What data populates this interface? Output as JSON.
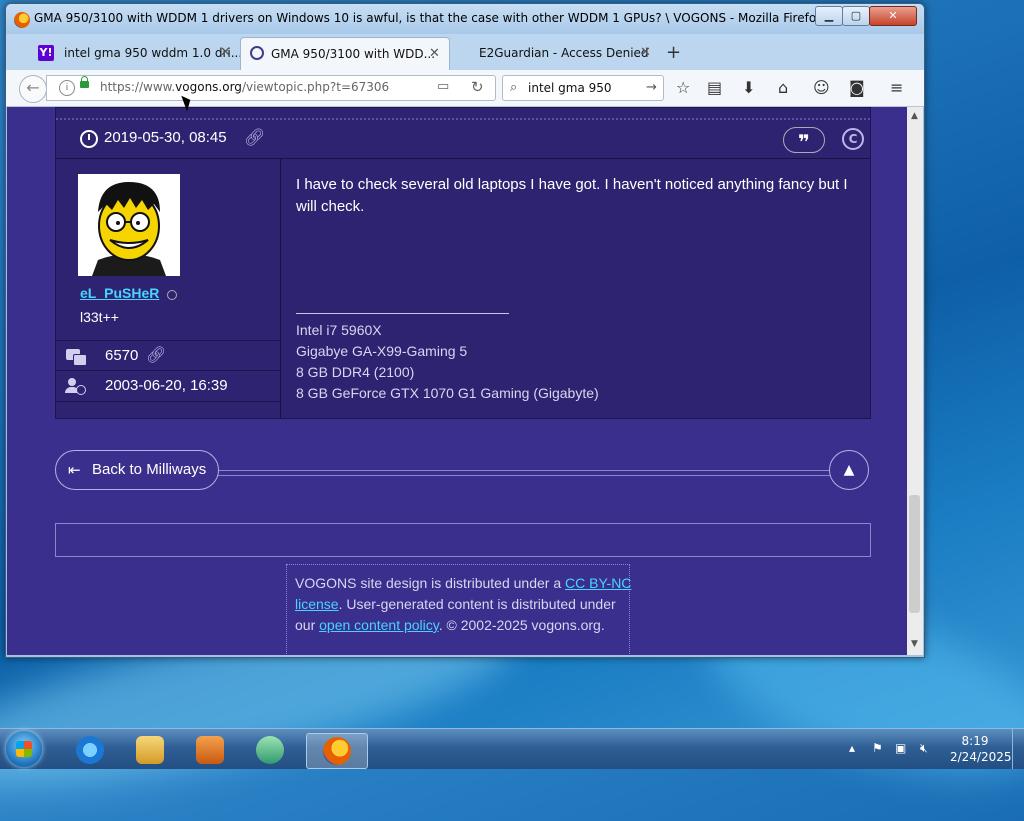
{
  "window": {
    "title": "GMA 950/3100 with WDDM 1 drivers on Windows 10 is awful, is that the case with other WDDM 1 GPUs? \\ VOGONS - Mozilla Firefox",
    "minimize": "▁",
    "maximize": "▢",
    "close": "✕"
  },
  "tabs": [
    {
      "label": "intel gma 950 wddm 1.0 dri...",
      "favicon": "Y!"
    },
    {
      "label": "GMA 950/3100 with WDD..."
    },
    {
      "label": "E2Guardian - Access Denied"
    }
  ],
  "tab_close": "✕",
  "new_tab": "+",
  "nav": {
    "url_prefix": "https://www.",
    "url_domain": "vogons.org",
    "url_path": "/viewtopic.php?t=67306",
    "search_value": "intel gma 950"
  },
  "post": {
    "date": "2019-05-30, 08:45",
    "quote": "❞",
    "copyright": "C",
    "username": "eL_PuSHeR",
    "rank": "l33t++",
    "post_count": "6570",
    "joined": "2003-06-20, 16:39",
    "body": "I have to check several old laptops I have got. I haven't noticed anything fancy but I will check.",
    "signature": [
      "Intel i7 5960X",
      "Gigabye GA-X99-Gaming 5",
      "8 GB DDR4 (2100)",
      "8 GB GeForce GTX 1070 G1 Gaming (Gigabyte)"
    ]
  },
  "back_link": "Back to Milliways",
  "footer": {
    "t1": "VOGONS site design is distributed under a ",
    "cc": "CC BY-NC",
    "license": "license",
    "t2": ". User-generated content is distributed under our ",
    "policy": "open content policy",
    "t3": ". © 2002-2025 vogons.org."
  },
  "taskbar": {
    "time": "8:19",
    "date": "2/24/2025"
  },
  "colors": {
    "page_bg": "#3a2f8c",
    "post_bg": "#2e2371",
    "link": "#48d4ff"
  }
}
